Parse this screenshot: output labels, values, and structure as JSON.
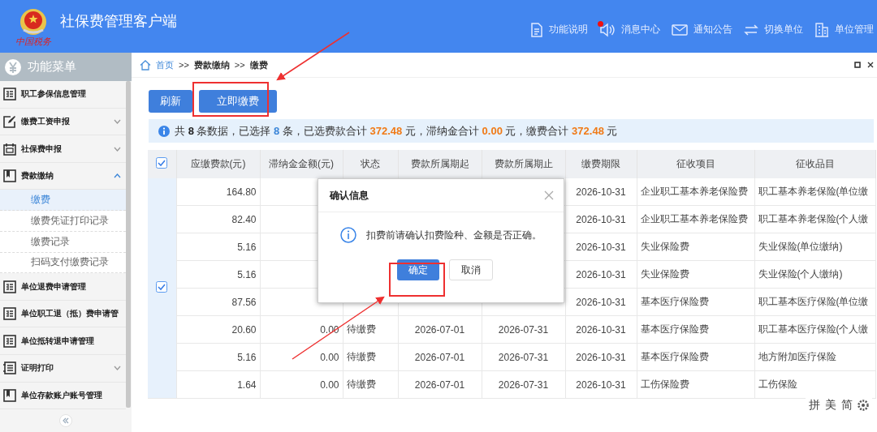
{
  "header": {
    "title": "社保费管理客户端",
    "logo_caption": "中国税务",
    "nav": [
      {
        "label": "功能说明",
        "kind": "doc",
        "badge": false
      },
      {
        "label": "消息中心",
        "kind": "speaker",
        "badge": true
      },
      {
        "label": "通知公告",
        "kind": "mail",
        "badge": false
      },
      {
        "label": "切换单位",
        "kind": "swap",
        "badge": false
      },
      {
        "label": "单位管理",
        "kind": "building",
        "badge": false
      }
    ]
  },
  "sidebar": {
    "title": "功能菜单",
    "items": [
      {
        "label": "职工参保信息管理",
        "kind": "link"
      },
      {
        "label": "缴费工资申报",
        "kind": "group",
        "expanded": false
      },
      {
        "label": "社保费申报",
        "kind": "group",
        "expanded": false
      },
      {
        "label": "费款缴纳",
        "kind": "group",
        "expanded": true,
        "children": [
          {
            "label": "缴费",
            "selected": true
          },
          {
            "label": "缴费凭证打印记录",
            "selected": false
          },
          {
            "label": "缴费记录",
            "selected": false
          },
          {
            "label": "扫码支付缴费记录",
            "selected": false
          }
        ]
      },
      {
        "label": "单位退费申请管理",
        "kind": "link"
      },
      {
        "label": "单位职工退（抵）费申请管",
        "kind": "link"
      },
      {
        "label": "单位抵转退申请管理",
        "kind": "link"
      },
      {
        "label": "证明打印",
        "kind": "group",
        "expanded": false
      },
      {
        "label": "单位存款账户账号管理",
        "kind": "link"
      }
    ]
  },
  "breadcrumb": {
    "items": [
      "首页",
      "费款缴纳",
      "缴费"
    ],
    "separator": ">>"
  },
  "toolbar": [
    {
      "label": "刷新"
    },
    {
      "label": "立即缴费"
    }
  ],
  "summary": [
    {
      "kind": "text",
      "text": "共 "
    },
    {
      "kind": "count",
      "text": "8"
    },
    {
      "kind": "text",
      "text": " 条数据，已选择 "
    },
    {
      "kind": "selected",
      "text": "8"
    },
    {
      "kind": "text",
      "text": " 条，已选费款合计 "
    },
    {
      "kind": "amount",
      "text": "372.48"
    },
    {
      "kind": "text",
      "text": " 元，滞纳金合计 "
    },
    {
      "kind": "amount",
      "text": "0.00"
    },
    {
      "kind": "text",
      "text": " 元，缴费合计 "
    },
    {
      "kind": "amount",
      "text": "372.48"
    },
    {
      "kind": "text",
      "text": " 元"
    }
  ],
  "table": {
    "all_checked": true,
    "rows_checked": true,
    "columns": [
      "应缴费款(元)",
      "滞纳金金额(元)",
      "状态",
      "费款所属期起",
      "费款所属期止",
      "缴费期限",
      "征收项目",
      "征收品目"
    ],
    "rows": [
      {
        "amount": "164.80",
        "deadline": "2026-10-31",
        "item": "企业职工基本养老保险费",
        "subitem": "职工基本养老保险(单位缴"
      },
      {
        "amount": "82.40",
        "deadline": "2026-10-31",
        "item": "企业职工基本养老保险费",
        "subitem": "职工基本养老保险(个人缴"
      },
      {
        "amount": "5.16",
        "deadline": "2026-10-31",
        "item": "失业保险费",
        "subitem": "失业保险(单位缴纳)"
      },
      {
        "amount": "5.16",
        "deadline": "2026-10-31",
        "item": "失业保险费",
        "subitem": "失业保险(个人缴纳)"
      },
      {
        "amount": "87.56",
        "deadline": "2026-10-31",
        "item": "基本医疗保险费",
        "subitem": "职工基本医疗保险(单位缴"
      },
      {
        "amount": "20.60",
        "late_fee": "0.00",
        "status": "待缴费",
        "period_start": "2026-07-01",
        "period_end": "2026-07-31",
        "deadline": "2026-10-31",
        "item": "基本医疗保险费",
        "subitem": "职工基本医疗保险(个人缴"
      },
      {
        "amount": "5.16",
        "late_fee": "0.00",
        "status": "待缴费",
        "period_start": "2026-07-01",
        "period_end": "2026-07-31",
        "deadline": "2026-10-31",
        "item": "基本医疗保险费",
        "subitem": "地方附加医疗保险"
      },
      {
        "amount": "1.64",
        "late_fee": "0.00",
        "status": "待缴费",
        "period_start": "2026-07-01",
        "period_end": "2026-07-31",
        "deadline": "2026-10-31",
        "item": "工伤保险费",
        "subitem": "工伤保险"
      }
    ]
  },
  "dialog": {
    "title": "确认信息",
    "message": "扣费前请确认扣费险种、金额是否正确。",
    "buttons": [
      {
        "label": "确定",
        "kind": "primary"
      },
      {
        "label": "取消",
        "kind": "default"
      }
    ]
  },
  "ime_toolbar": [
    "拼",
    "美",
    "简"
  ]
}
